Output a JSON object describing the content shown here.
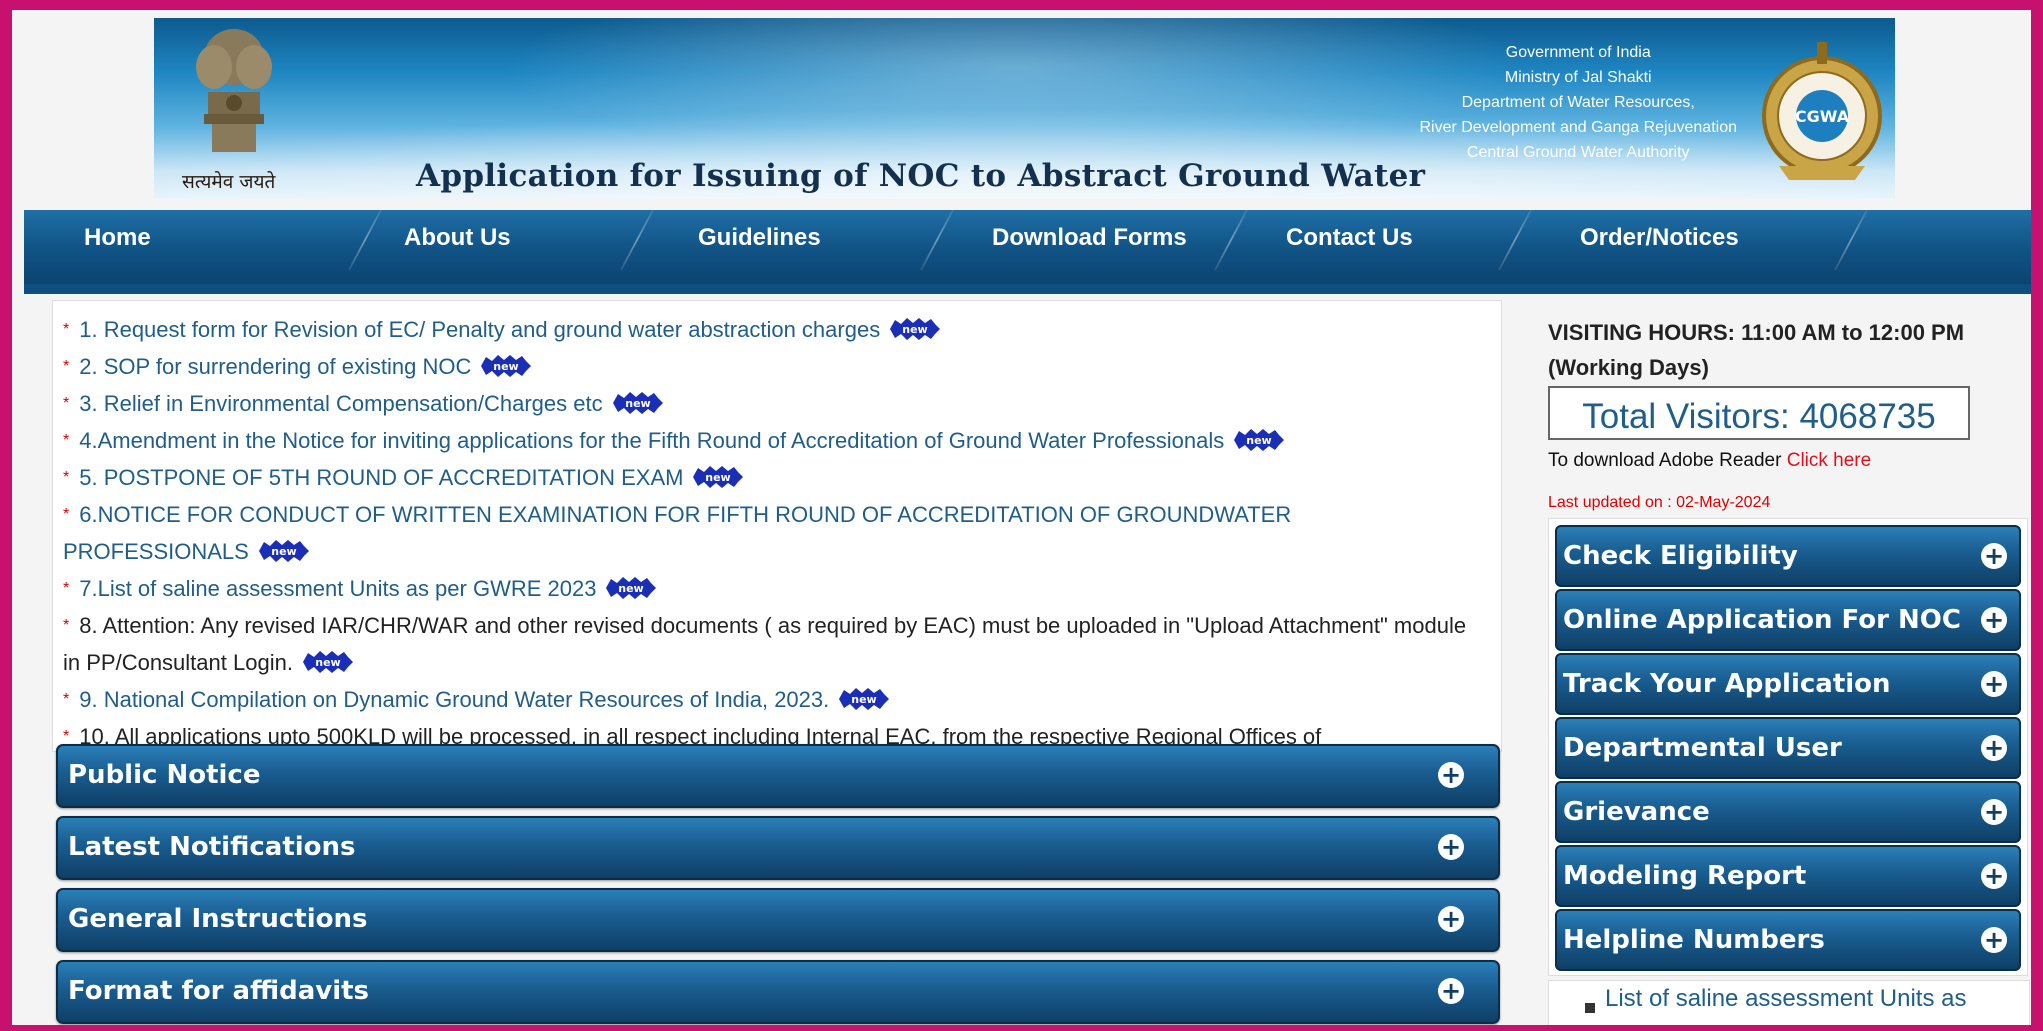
{
  "banner": {
    "motto": "सत्यमेव जयते",
    "title": "Application for Issuing of NOC to Abstract Ground Water",
    "gov_lines": [
      "Government of India",
      "Ministry of Jal Shakti",
      "Department of Water Resources,",
      "River Development and Ganga Rejuvenation",
      "Central Ground Water Authority"
    ],
    "logo_text": "CGWA"
  },
  "nav": {
    "items": [
      "Home",
      "About Us",
      "Guidelines",
      "Download Forms",
      "Contact Us",
      "Order/Notices"
    ]
  },
  "news": {
    "badge": "new",
    "items": [
      {
        "text": "1. Request form for Revision of EC/ Penalty and ground water abstraction charges",
        "new": true
      },
      {
        "text": "2. SOP for surrendering of existing NOC",
        "new": true
      },
      {
        "text": "3. Relief in Environmental Compensation/Charges etc",
        "new": true
      },
      {
        "text": "4.Amendment in the Notice for inviting applications for the Fifth Round of Accreditation of Ground Water Professionals",
        "new": true
      },
      {
        "text": "5. POSTPONE OF 5TH ROUND OF ACCREDITATION EXAM",
        "new": true
      },
      {
        "text": "6.NOTICE FOR CONDUCT OF WRITTEN EXAMINATION FOR FIFTH ROUND OF ACCREDITATION OF GROUNDWATER PROFESSIONALS",
        "new": true
      },
      {
        "text": "7.List of saline assessment Units as per GWRE 2023",
        "new": true
      },
      {
        "text": "8. Attention: Any revised IAR/CHR/WAR and other revised documents ( as required by EAC) must be uploaded in \"Upload Attachment\" module in PP/Consultant Login.",
        "new": true,
        "dark": true
      },
      {
        "text": "9. National Compilation on Dynamic Ground Water Resources of India, 2023.",
        "new": true
      },
      {
        "text": "10. All applications upto 500KLD will be processed, in all respect including Internal EAC, from the respective Regional Offices of",
        "new": false,
        "dark": true
      }
    ]
  },
  "accordions": [
    "Public Notice",
    "Latest Notifications",
    "General Instructions",
    "Format for affidavits"
  ],
  "right": {
    "visiting": "VISITING HOURS: 11:00 AM to 12:00 PM (Working Days)",
    "visitors": "Total Visitors: 4068735",
    "adobe_prefix": "To download Adobe Reader ",
    "adobe_link": "Click here",
    "updated": "Last updated on : 02-May-2024",
    "menu": [
      "Check Eligibility",
      "Online Application For NOC",
      "Track Your Application",
      "Departmental User",
      "Grievance",
      "Modeling Report",
      "Helpline Numbers"
    ],
    "notice": "List of saline assessment Units as"
  },
  "colors": {
    "frame_border": "#c8106e",
    "nav_bg": "#105284",
    "link_blue": "#205e8a",
    "star_red": "#dd0000"
  }
}
